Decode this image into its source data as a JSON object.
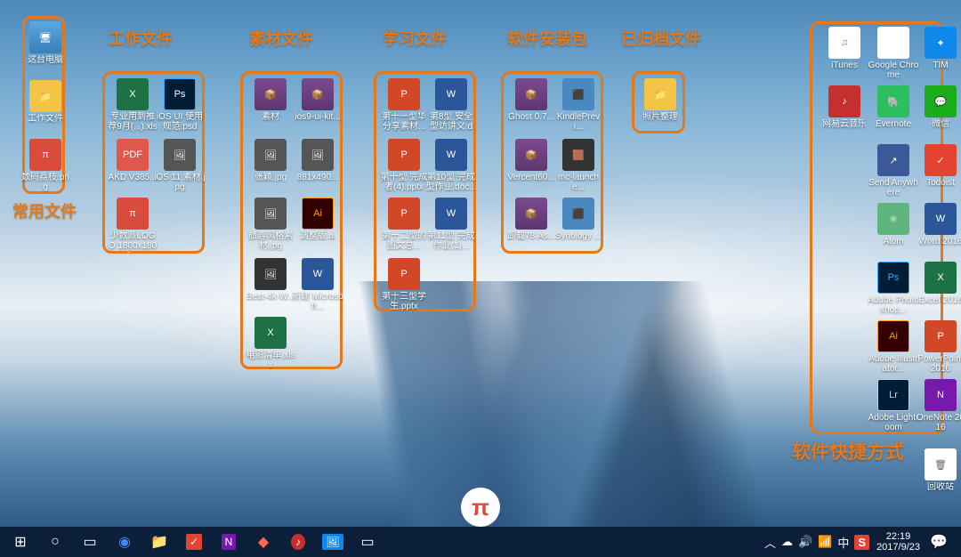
{
  "groups": {
    "common": {
      "label": "常用文件"
    },
    "work": {
      "label": "工作文件"
    },
    "material": {
      "label": "素材文件"
    },
    "study": {
      "label": "学习文件"
    },
    "installer": {
      "label": "软件安装包"
    },
    "archived": {
      "label": "已归档文件"
    },
    "shortcuts": {
      "label": "软件快捷方式"
    }
  },
  "left_col": [
    {
      "label": "这台电脑",
      "type": "pc"
    },
    {
      "label": "工作文件",
      "type": "folder"
    },
    {
      "label": "数码荔枝.png",
      "type": "pi"
    }
  ],
  "work_files": [
    {
      "label": "专业用到推荐9月(...).xlsx",
      "type": "xlsx"
    },
    {
      "label": "iOS UI 使用规范.psd",
      "type": "psd"
    },
    {
      "label": "AKD V385...",
      "type": "pdf"
    },
    {
      "label": "iOS 11 素材.jpg",
      "type": "jpg"
    },
    {
      "label": "少数派LOGO 1800x1800...",
      "type": "pi"
    }
  ],
  "material_files": [
    {
      "label": "素材",
      "type": "rar"
    },
    {
      "label": "ios9-ui-kit...",
      "type": "rar"
    },
    {
      "label": "张颖.jpg",
      "type": "jpg"
    },
    {
      "label": "881x490...",
      "type": "jpg"
    },
    {
      "label": "旅游风格素材.jpg",
      "type": "jpg"
    },
    {
      "label": "调整版.ai",
      "type": "ai"
    },
    {
      "label": "Best-4k-W...",
      "type": "img"
    },
    {
      "label": "新建 Microsoft...",
      "type": "docx"
    },
    {
      "label": "电影清单.xlsx",
      "type": "xlsx"
    }
  ],
  "study_files": [
    {
      "label": "第十一型华分享素材...",
      "type": "pptx"
    },
    {
      "label": "第8型 安全型访讲义.do...",
      "type": "docx"
    },
    {
      "label": "第十型 完成者(4).pptx",
      "type": "pptx"
    },
    {
      "label": "第10型 完成型作业.doc...",
      "type": "docx"
    },
    {
      "label": "第十二型的图文总...",
      "type": "pptx"
    },
    {
      "label": "第11型 完成作业(1)...",
      "type": "docx"
    },
    {
      "label": "第十三型学生.pptx",
      "type": "pptx"
    }
  ],
  "installer_files": [
    {
      "label": "Ghost 0.7...",
      "type": "rar"
    },
    {
      "label": "KindlePrevi...",
      "type": "exe"
    },
    {
      "label": "Vercent60...",
      "type": "rar"
    },
    {
      "label": "mc-launche...",
      "type": "img"
    },
    {
      "label": "卸载78 As...",
      "type": "rar"
    },
    {
      "label": "Synology ...",
      "type": "exe"
    }
  ],
  "archived_files": [
    {
      "label": "照片整理",
      "type": "folder"
    }
  ],
  "right_icons": [
    {
      "label": "iTunes",
      "type": "itunes",
      "ico": "♫"
    },
    {
      "label": "Google Chrome",
      "type": "chrome",
      "ico": "◉"
    },
    {
      "label": "TIM",
      "type": "tim",
      "ico": "✦"
    },
    {
      "label": "网易云音乐",
      "type": "netease",
      "ico": "♪"
    },
    {
      "label": "Evernote",
      "type": "evernote",
      "ico": "🐘"
    },
    {
      "label": "微信",
      "type": "wechat",
      "ico": "💬"
    },
    {
      "label": "Send Anywhere",
      "type": "sa",
      "ico": "↗"
    },
    {
      "label": "Todoist",
      "type": "todoist",
      "ico": "✓"
    },
    {
      "label": "Atom",
      "type": "atom",
      "ico": "⚛"
    },
    {
      "label": "Word 2016",
      "type": "word",
      "ico": "W"
    },
    {
      "label": "Adobe Photoshop...",
      "type": "ps",
      "ico": "Ps"
    },
    {
      "label": "Excel 2016",
      "type": "excel",
      "ico": "X"
    },
    {
      "label": "Adobe Illustrator...",
      "type": "ai",
      "ico": "Ai"
    },
    {
      "label": "PowerPoint 2016",
      "type": "ppt",
      "ico": "P"
    },
    {
      "label": "Adobe Lightroom",
      "type": "lr",
      "ico": "Lr"
    },
    {
      "label": "OneNote 2016",
      "type": "onenote",
      "ico": "N"
    }
  ],
  "recycle_bin": {
    "label": "回收站"
  },
  "taskbar": {
    "time": "22:19",
    "date": "2017/9/23"
  }
}
